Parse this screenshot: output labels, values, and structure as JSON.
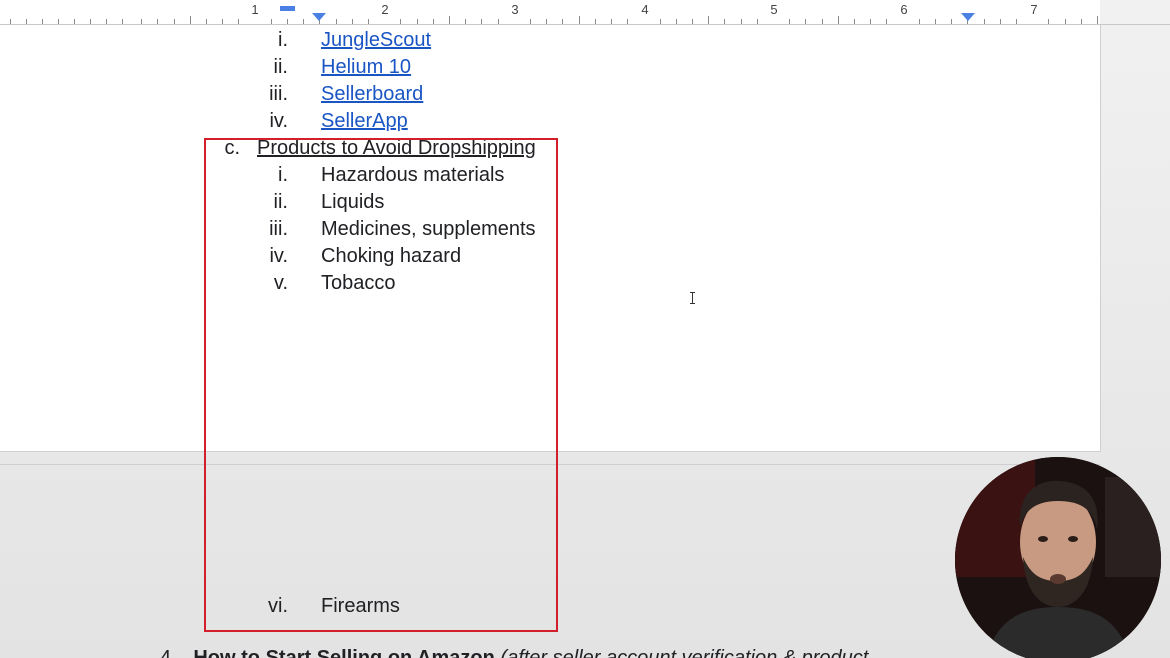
{
  "ruler": {
    "numbers": [
      "1",
      "2",
      "3",
      "4",
      "5",
      "6",
      "7"
    ]
  },
  "list": {
    "tools": [
      {
        "marker": "i.",
        "label": "JungleScout"
      },
      {
        "marker": "ii.",
        "label": "Helium 10"
      },
      {
        "marker": "iii.",
        "label": "Sellerboard"
      },
      {
        "marker": "iv.",
        "label": "SellerApp"
      }
    ],
    "section_c": {
      "marker": "c.",
      "heading": "Products to Avoid Dropshipping",
      "items": [
        {
          "marker": "i.",
          "label": "Hazardous materials"
        },
        {
          "marker": "ii.",
          "label": "Liquids"
        },
        {
          "marker": "iii.",
          "label": "Medicines, supplements"
        },
        {
          "marker": "iv.",
          "label": "Choking hazard"
        },
        {
          "marker": "v.",
          "label": "Tobacco"
        },
        {
          "marker": "vi.",
          "label": "Firearms"
        }
      ]
    }
  },
  "next_section": {
    "number": "4.",
    "title": "How to Start Selling on Amazon",
    "subtitle": "(after seller account verification & product"
  },
  "colors": {
    "link": "#1a55c4",
    "highlight_border": "#d21f2b",
    "ruler_marker": "#4a7fe3"
  },
  "icons": {
    "first_line_indent": "first-line-indent-icon",
    "left_indent": "left-indent-icon",
    "right_indent": "right-indent-icon",
    "text_cursor": "text-cursor-icon"
  }
}
